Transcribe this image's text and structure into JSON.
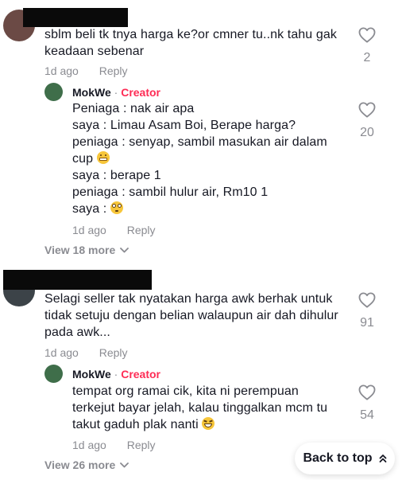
{
  "colors": {
    "text": "#161823",
    "muted": "#8a8b91",
    "creator": "#fe2c55",
    "background": "#ffffff"
  },
  "comments": [
    {
      "text_lines": [
        "sblm beli tk tnya harga ke?or cmner tu..nk tahu gak",
        "keadaan sebenar"
      ],
      "time": "1d ago",
      "reply_label": "Reply",
      "likes": "2",
      "replies": [
        {
          "author": "MokWe",
          "separator": "·",
          "badge": "Creator",
          "text_lines": [
            "Peniaga : nak air apa",
            "saya : Limau Asam Boi, Berape harga?",
            "peniaga : senyap, sambil masukan air dalam",
            "cup",
            "saya : berape 1",
            "peniaga : sambil hulur air, Rm10 1",
            "saya :"
          ],
          "emojis": [
            "grimacing-face-emoji",
            "flushed-face-emoji"
          ],
          "time": "1d ago",
          "reply_label": "Reply",
          "likes": "20"
        }
      ],
      "view_more": "View 18 more"
    },
    {
      "text_lines": [
        "Selagi seller tak nyatakan harga awk berhak untuk",
        "tidak setuju dengan belian walaupun air dah dihulur",
        "pada awk..."
      ],
      "time": "1d ago",
      "reply_label": "Reply",
      "likes": "91",
      "replies": [
        {
          "author": "MokWe",
          "separator": "·",
          "badge": "Creator",
          "text_lines": [
            "tempat org ramai cik, kita ni perempuan",
            "terkejut bayar jelah, kalau tinggalkan mcm tu",
            "takut gaduh plak nanti"
          ],
          "emojis": [
            "grinning-squinting-face-emoji"
          ],
          "time": "1d ago",
          "reply_label": "Reply",
          "likes": "54"
        }
      ],
      "view_more": "View 26 more"
    }
  ],
  "back_to_top": {
    "label": "Back to top",
    "icon": "double-chevron-up-icon"
  }
}
